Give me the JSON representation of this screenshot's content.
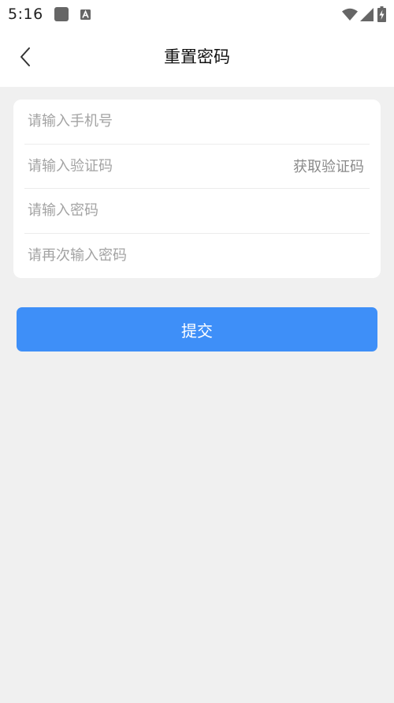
{
  "status_bar": {
    "time": "5:16",
    "icons": [
      "notification-square-icon",
      "a-app-icon",
      "wifi-icon",
      "signal-icon",
      "battery-charging-icon"
    ]
  },
  "header": {
    "title": "重置密码",
    "back_icon": "chevron-left-icon"
  },
  "form": {
    "phone_placeholder": "请输入手机号",
    "code_placeholder": "请输入验证码",
    "get_code_label": "获取验证码",
    "password_placeholder": "请输入密码",
    "confirm_password_placeholder": "请再次输入密码"
  },
  "submit_label": "提交",
  "colors": {
    "accent": "#3e8ff8",
    "background": "#f0f0f0",
    "card": "#ffffff"
  }
}
